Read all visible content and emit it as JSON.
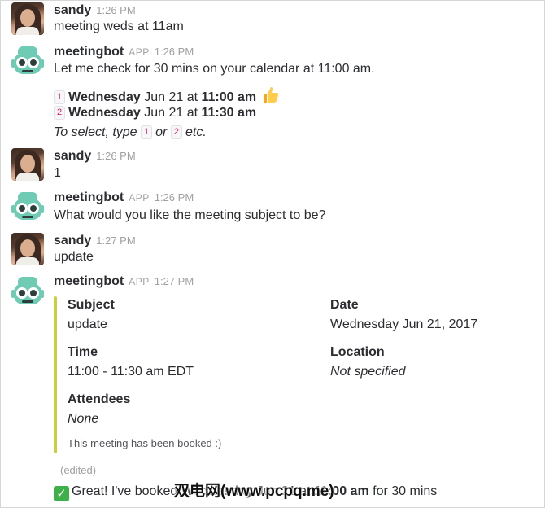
{
  "messages": [
    {
      "author": "sandy",
      "time": "1:26 PM",
      "text": "meeting weds at 11am"
    },
    {
      "author": "meetingbot",
      "badge": "APP",
      "time": "1:26 PM",
      "text": "Let me check for 30 mins on your calendar at 11:00 am.",
      "options": [
        {
          "num": "1",
          "day": "Wednesday",
          "date": "Jun 21 at",
          "time": "11:00 am",
          "emoji": "thumbs-up"
        },
        {
          "num": "2",
          "day": "Wednesday",
          "date": "Jun 21 at",
          "time": "11:30 am"
        }
      ],
      "hint": {
        "prefix": "To select, type",
        "opt1": "1",
        "or": "or",
        "opt2": "2",
        "suffix": "etc."
      }
    },
    {
      "author": "sandy",
      "time": "1:26 PM",
      "text": "1"
    },
    {
      "author": "meetingbot",
      "badge": "APP",
      "time": "1:26 PM",
      "text": "What would you like the meeting subject to be?"
    },
    {
      "author": "sandy",
      "time": "1:27 PM",
      "text": "update"
    },
    {
      "author": "meetingbot",
      "badge": "APP",
      "time": "1:27 PM",
      "attachment": {
        "fields": [
          {
            "label": "Subject",
            "value": "update"
          },
          {
            "label": "Date",
            "value": "Wednesday Jun 21, 2017"
          },
          {
            "label": "Time",
            "value": "11:00 - 11:30 am EDT"
          },
          {
            "label": "Location",
            "value": "Not specified"
          },
          {
            "label": "Attendees",
            "value": "None"
          }
        ],
        "footer": "This meeting has been booked :)",
        "accent_color": "#c9d03d"
      },
      "edited": "(edited)",
      "confirm": {
        "prefix": "Great! I've booked",
        "day": "Wednesday",
        "date": "Jun 21 at",
        "time": "11:00 am",
        "suffix": "for 30 mins"
      }
    }
  ],
  "watermark": "双电网(www.pcpq.me)"
}
